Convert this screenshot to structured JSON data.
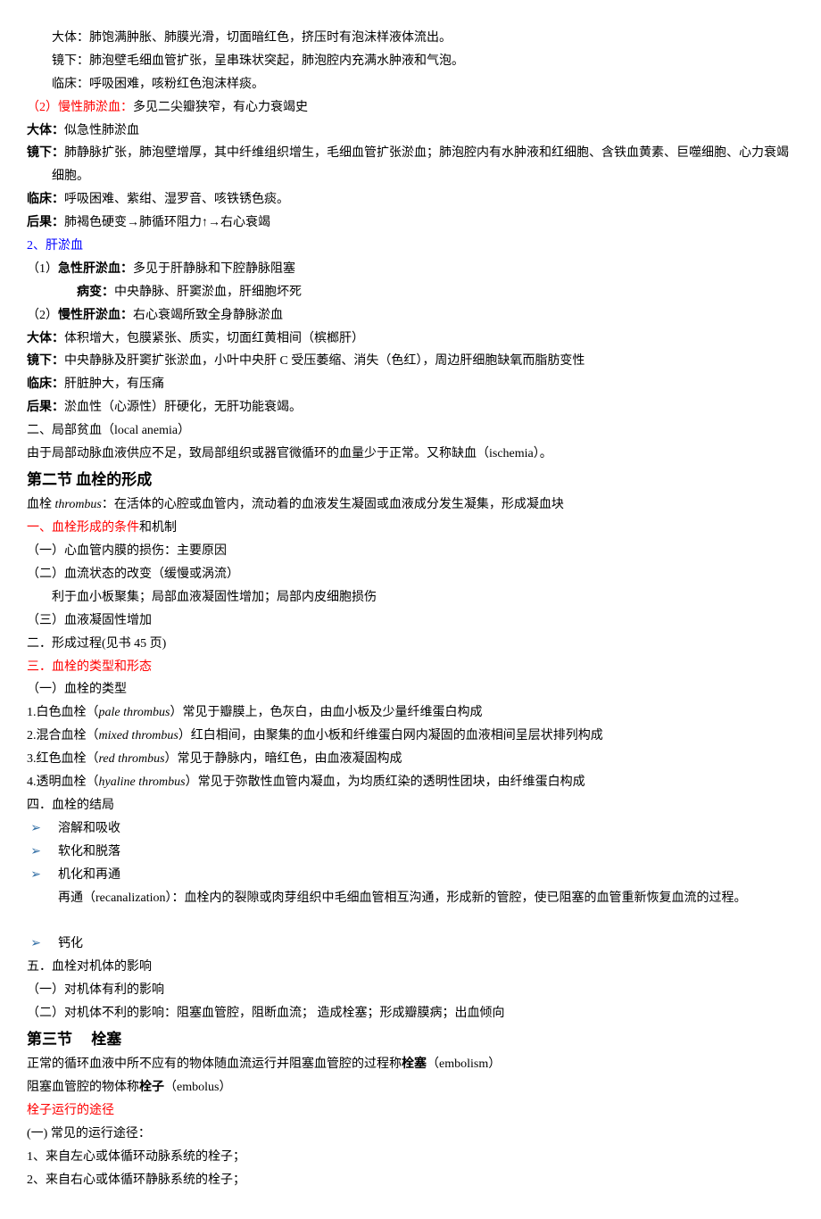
{
  "p1": "大体：肺饱满肿胀、肺膜光滑，切面暗红色，挤压时有泡沫样液体流出。",
  "p2": "镜下：肺泡壁毛细血管扩张，呈串珠状突起，肺泡腔内充满水肿液和气泡。",
  "p3": "临床：呼吸困难，咳粉红色泡沫样痰。",
  "p4a": "（2）慢性肺淤血：",
  "p4b": "多见二尖瓣狭窄，有心力衰竭史",
  "p5a": "大体：",
  "p5b": "似急性肺淤血",
  "p6a": "镜下：",
  "p6b": "肺静脉扩张，肺泡壁增厚，其中纤维组织增生，毛细血管扩张淤血；肺泡腔内有水肿液和红细胞、含铁血黄素、巨噬细胞、心力衰竭",
  "p6c": "细胞。",
  "p7a": "临床：",
  "p7b": "呼吸困难、紫绀、湿罗音、咳铁锈色痰。",
  "p8a": "后果：",
  "p8b": "肺褐色硬变→肺循环阻力↑→右心衰竭",
  "p9": "2、肝淤血",
  "p10a": "（1）",
  "p10b": "急性肝淤血：",
  "p10c": "多见于肝静脉和下腔静脉阻塞",
  "p11a": "病变：",
  "p11b": "中央静脉、肝窦淤血，肝细胞坏死",
  "p12a": "（2）",
  "p12b": "慢性肝淤血：",
  "p12c": "右心衰竭所致全身静脉淤血",
  "p13a": "大体：",
  "p13b": "体积增大，包膜紧张、质实，切面红黄相间（槟榔肝）",
  "p14a": "镜下：",
  "p14b": "中央静脉及肝窦扩张淤血，小叶中央肝 C 受压萎缩、消失（色红），周边肝细胞缺氧而脂肪变性",
  "p15a": "临床：",
  "p15b": "肝脏肿大，有压痛",
  "p16a": "后果：",
  "p16b": "淤血性（心源性）肝硬化，无肝功能衰竭。",
  "p17": "二、局部贫血（local anemia）",
  "p18": "由于局部动脉血液供应不足，致局部组织或器官微循环的血量少于正常。又称缺血（ischemia）。",
  "sec2": "第二节 血栓的形成",
  "p19a": "血栓 ",
  "p19b": "thrombus",
  "p19c": "：在活体的心腔或血管内，流动着的血液发生凝固或血液成分发生凝集，形成凝血块",
  "p20a": "一、血栓形成的条件",
  "p20b": "和机制",
  "p21": "（一）心血管内膜的损伤：主要原因",
  "p22": "（二）血流状态的改变（缓慢或涡流）",
  "p23": "利于血小板聚集；局部血液凝固性增加；局部内皮细胞损伤",
  "p24": "（三）血液凝固性增加",
  "p25": "二．形成过程(见书 45 页)",
  "p26": "三．血栓的类型和形态",
  "p27": "（一）血栓的类型",
  "p28a": "1.白色血栓（",
  "p28b": "pale thrombus",
  "p28c": "）常见于瓣膜上，色灰白，由血小板及少量纤维蛋白构成",
  "p29a": "2.混合血栓（",
  "p29b": "mixed thrombus",
  "p29c": "）红白相间，由聚集的血小板和纤维蛋白网内凝固的血液相间呈层状排列构成",
  "p30a": "3.红色血栓（",
  "p30b": "red thrombus",
  "p30c": "）常见于静脉内，暗红色，由血液凝固构成",
  "p31a": "4.透明血栓（",
  "p31b": "hyaline thrombus",
  "p31c": "）常见于弥散性血管内凝血，为均质红染的透明性团块，由纤维蛋白构成",
  "p32": "四．血栓的结局",
  "b1": "溶解和吸收",
  "b2": "软化和脱落",
  "b3": "机化和再通",
  "p33": "再通（recanalization）：血栓内的裂隙或肉芽组织中毛细血管相互沟通，形成新的管腔，使已阻塞的血管重新恢复血流的过程。",
  "b4": "钙化",
  "p34": "五．血栓对机体的影响",
  "p35": "（一）对机体有利的影响",
  "p36": "（二）对机体不利的影响：阻塞血管腔，阻断血流； 造成栓塞；形成瓣膜病；出血倾向",
  "sec3a": "第三节",
  "sec3b": "栓塞",
  "p37a": "正常的循环血液中所不应有的物体随血流运行并阻塞血管腔的过程称",
  "p37b": "栓塞",
  "p37c": "（embolism）",
  "p38a": "阻塞血管腔的物体称",
  "p38b": "栓子",
  "p38c": "（embolus）",
  "p39": "栓子运行的途径",
  "p40": "(一) 常见的运行途径：",
  "p41": "1、来自左心或体循环动脉系统的栓子；",
  "p42": "2、来自右心或体循环静脉系统的栓子；"
}
